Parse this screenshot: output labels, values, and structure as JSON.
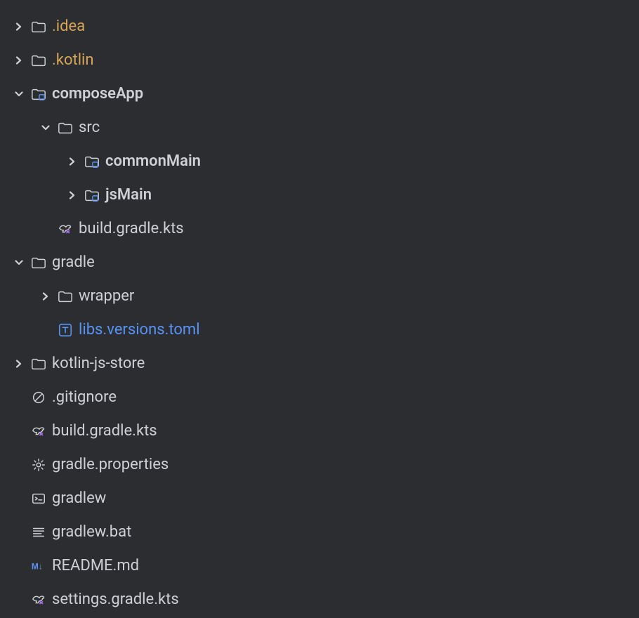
{
  "tree": {
    "idea": ".idea",
    "kotlin": ".kotlin",
    "composeApp": "composeApp",
    "src": "src",
    "commonMain": "commonMain",
    "jsMain": "jsMain",
    "buildGradleKts": "build.gradle.kts",
    "gradle": "gradle",
    "wrapper": "wrapper",
    "libsVersions": "libs.versions.toml",
    "kotlinJsStore": "kotlin-js-store",
    "gitignore": ".gitignore",
    "rootBuild": "build.gradle.kts",
    "gradleProps": "gradle.properties",
    "gradlew": "gradlew",
    "gradlewBat": "gradlew.bat",
    "readme": "README.md",
    "settings": "settings.gradle.kts"
  }
}
